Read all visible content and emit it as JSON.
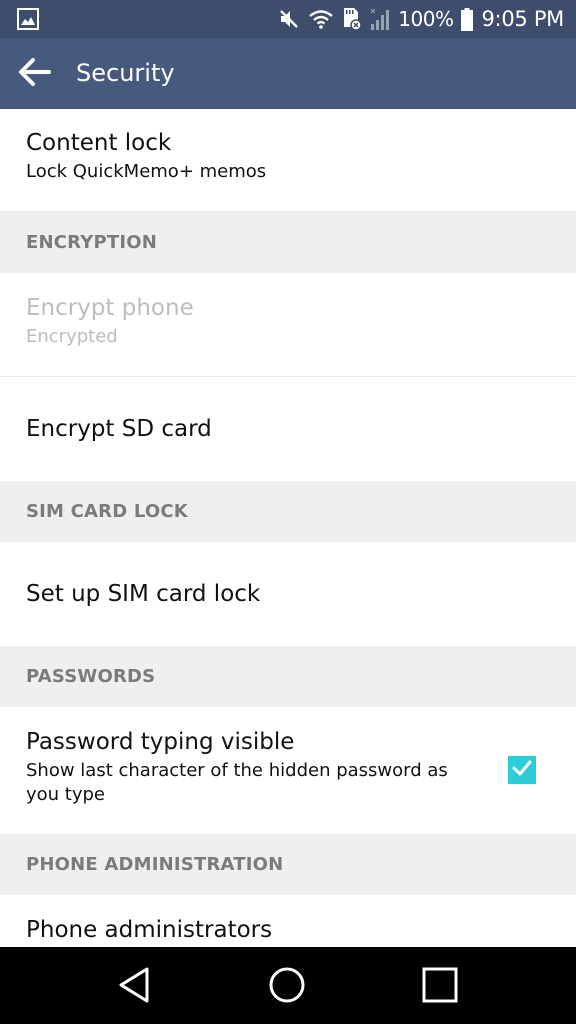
{
  "status_bar": {
    "left_icon": "gallery-notification-icon",
    "icons": [
      "mute-icon",
      "wifi-icon",
      "sd-card-error-icon",
      "no-signal-icon"
    ],
    "battery_percent": "100%",
    "battery_icon": "battery-full-icon",
    "time": "9:05 PM"
  },
  "app_bar": {
    "back_icon": "arrow-left-icon",
    "title": "Security"
  },
  "settings": {
    "content_lock": {
      "title": "Content lock",
      "summary": "Lock QuickMemo+ memos"
    },
    "encryption_header": "ENCRYPTION",
    "encrypt_phone": {
      "title": "Encrypt phone",
      "summary": "Encrypted",
      "enabled": false
    },
    "encrypt_sd": {
      "title": "Encrypt SD card"
    },
    "sim_header": "SIM CARD LOCK",
    "sim_lock": {
      "title": "Set up SIM card lock"
    },
    "passwords_header": "PASSWORDS",
    "password_visible": {
      "title": "Password typing visible",
      "summary": "Show last character of the hidden password as you type",
      "checked": true
    },
    "admin_header": "PHONE ADMINISTRATION",
    "phone_admins": {
      "title": "Phone administrators"
    }
  },
  "colors": {
    "status_bar": "#3d4d6b",
    "app_bar": "#455a7c",
    "accent": "#2dcdd6",
    "header_bg": "#efefef",
    "header_text": "#7b7b7b"
  },
  "nav_bar": {
    "back": "nav-back-icon",
    "home": "nav-home-icon",
    "recents": "nav-recents-icon"
  }
}
